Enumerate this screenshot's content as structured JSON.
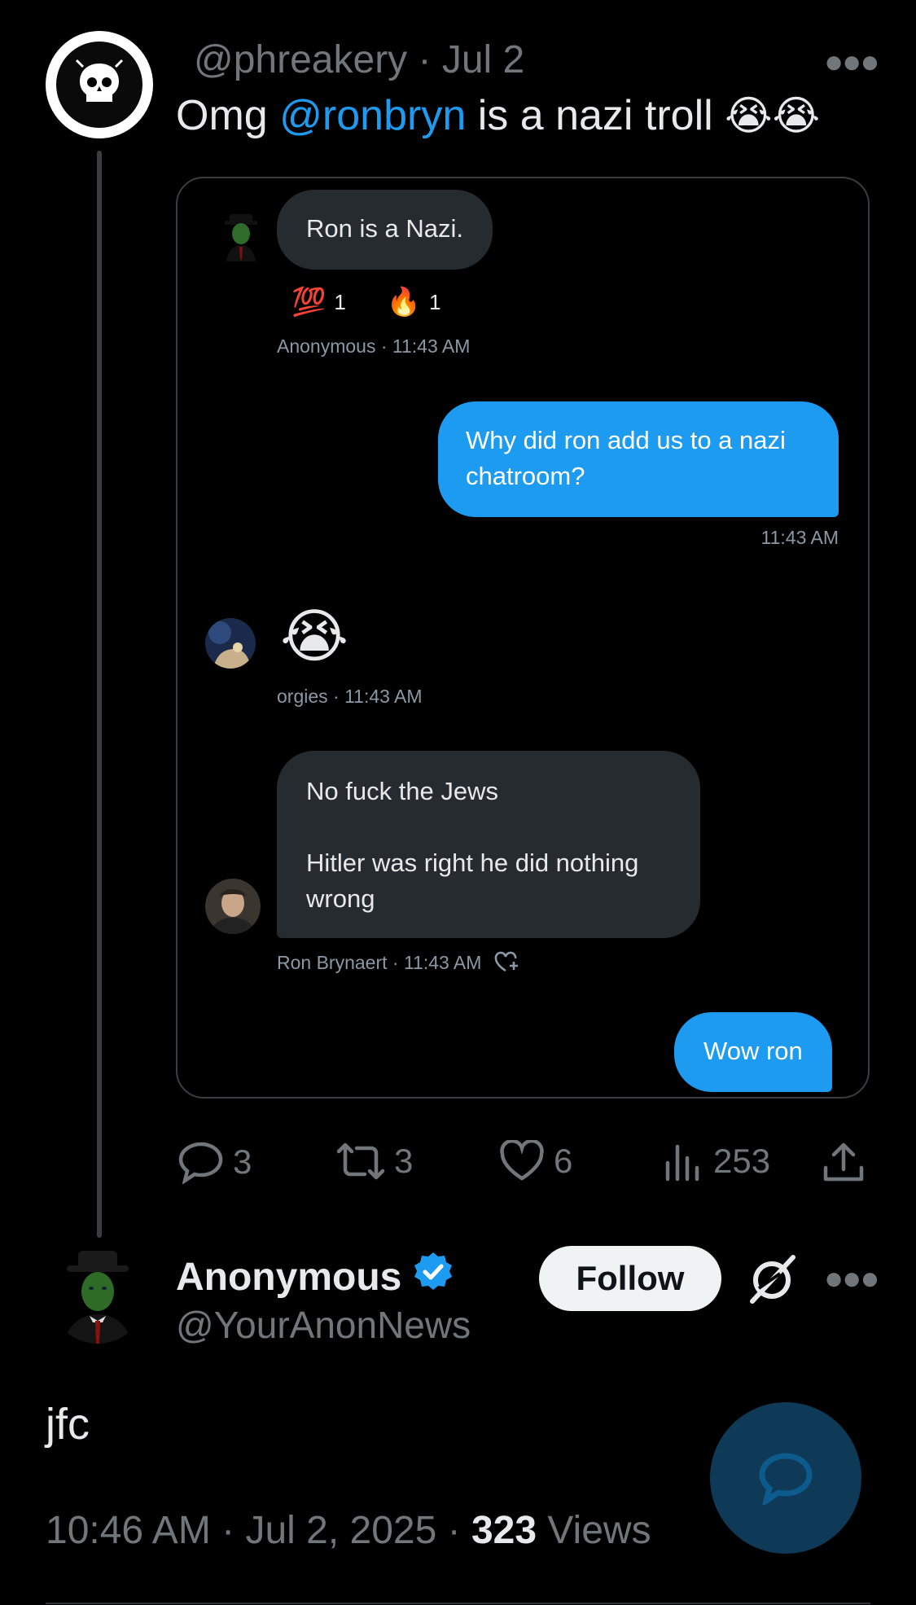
{
  "tweet": {
    "handle": "@phreakery",
    "separator": "·",
    "date": "Jul 2",
    "text_before": "Omg ",
    "mention": "@ronbryn",
    "text_after": " is a nazi troll ",
    "emojis": "😭😭",
    "avatar_icon": "skull-logo-icon"
  },
  "chat": {
    "msg1": {
      "text": "Ron is a Nazi.",
      "reaction1_emoji": "💯",
      "reaction1_count": "1",
      "reaction2_emoji": "🔥",
      "reaction2_count": "1",
      "meta": "Anonymous · 11:43 AM"
    },
    "msg2": {
      "line1": "Why did ron add us to a nazi",
      "line2": "chatroom?",
      "time": "11:43 AM"
    },
    "msg3": {
      "emoji": "😭",
      "meta": "orgies · 11:43 AM"
    },
    "msg4": {
      "line1": "No fuck the Jews",
      "line2": "Hitler was right he did nothing",
      "line3": "wrong",
      "meta": "Ron Brynaert · 11:43 AM"
    },
    "msg5": {
      "text": "Wow ron"
    }
  },
  "actions": {
    "replies": "3",
    "reposts": "3",
    "likes": "6",
    "views": "253"
  },
  "reply": {
    "name": "Anonymous",
    "handle": "@YourAnonNews",
    "follow_label": "Follow",
    "text": "jfc",
    "time": "10:46 AM",
    "date": "Jul 2, 2025",
    "views_count": "323",
    "views_label": "Views"
  },
  "colors": {
    "accent": "#1d9bf0",
    "background": "#000000",
    "bubble_grey": "#262b30",
    "muted": "#71767b"
  }
}
